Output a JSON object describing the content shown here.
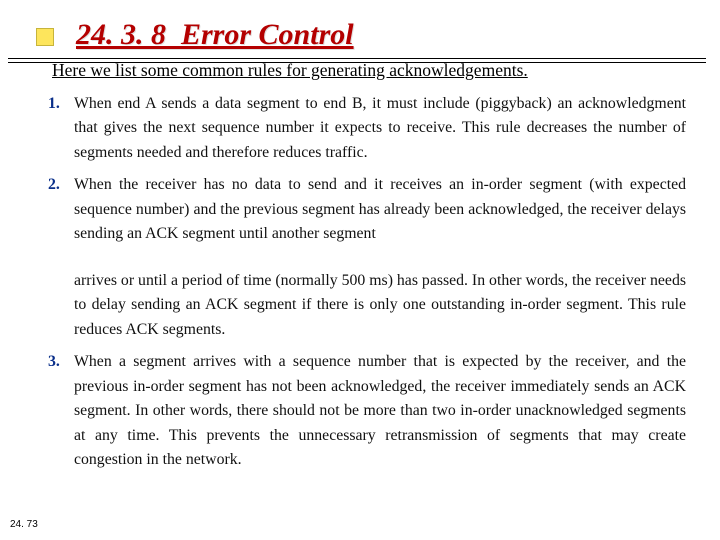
{
  "header": {
    "section_number": "24. 3. 8",
    "title": "Error Control"
  },
  "intro": "Here we list some common rules for generating acknowledgements.",
  "rules": [
    {
      "num": "1.",
      "text": "When end A sends a data segment to end B, it must include (piggyback) an acknowledgment that gives the next sequence number it expects to receive. This rule decreases the number of segments needed and therefore reduces traffic."
    },
    {
      "num": "2.",
      "text_a": "When the receiver has no data to send and it receives an in-order segment (with expected sequence number) and the previous segment has already been acknowledged, the receiver delays sending an ACK segment until another segment",
      "text_b": "arrives or until a period of time (normally 500 ms) has passed. In other words, the receiver needs to delay sending an ACK segment if there is only one outstanding in-order segment. This rule reduces ACK segments."
    },
    {
      "num": "3.",
      "text": "When a segment arrives with a sequence number that is expected by the receiver, and the previous in-order segment has not been acknowledged, the receiver immediately sends an ACK segment. In other words, there should not be more than two in-order unacknowledged segments at any time. This prevents the unnecessary retransmission of segments that may create congestion in the network."
    }
  ],
  "page_number": "24. 73"
}
